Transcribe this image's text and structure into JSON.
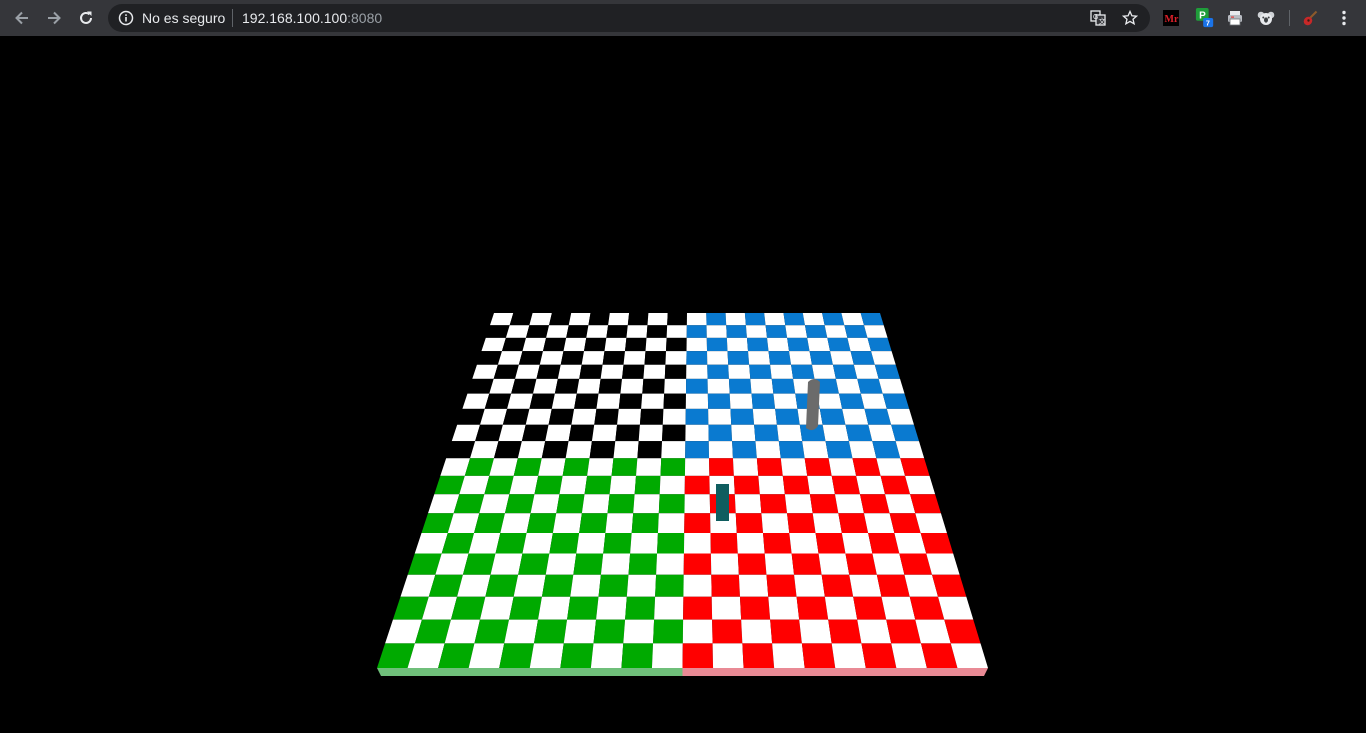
{
  "browser": {
    "security_label": "No es seguro",
    "url_host": "192.168.100.100",
    "url_port": ":8080",
    "extensions": [
      {
        "name": "mr-extension-icon",
        "text": "Mr",
        "badge": ""
      },
      {
        "name": "green-p-extension-icon",
        "text": "P",
        "badge": "7"
      },
      {
        "name": "printer-extension-icon",
        "text": "",
        "badge": ""
      },
      {
        "name": "koala-extension-icon",
        "text": "",
        "badge": ""
      },
      {
        "name": "guitar-extension-icon",
        "text": "",
        "badge": ""
      }
    ]
  },
  "scene": {
    "quadrant_colors": {
      "top_left": "#000000",
      "top_right": "#0a7ad0",
      "bottom_left": "#00aa00",
      "bottom_right": "#ff0000",
      "light": "#ffffff"
    },
    "board_cells_per_quadrant": 10,
    "pieces": [
      {
        "name": "gray-piece",
        "color": "#6b6b6b"
      },
      {
        "name": "teal-piece",
        "color": "#0f5d5f"
      }
    ]
  }
}
